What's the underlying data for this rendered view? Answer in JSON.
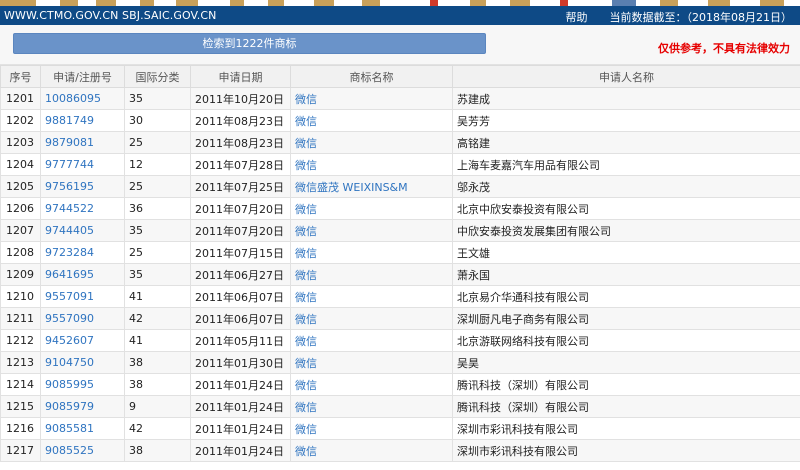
{
  "header": {
    "site": "WWW.CTMO.GOV.CN SBJ.SAIC.GOV.CN",
    "help": "帮助",
    "data_date": "当前数据截至：（2018年08月21日）"
  },
  "banner": {
    "result_button": "检索到1222件商标",
    "disclaimer": "仅供参考，不具有法律效力"
  },
  "colors": {
    "header_bg": "#0e4a86",
    "button_bg": "#6a93c9",
    "link": "#2f74c0",
    "disclaimer": "#e60000"
  },
  "table": {
    "columns": [
      "序号",
      "申请/注册号",
      "国际分类",
      "申请日期",
      "商标名称",
      "申请人名称"
    ],
    "rows": [
      {
        "seq": "1201",
        "reg": "10086095",
        "cls": "35",
        "date": "2011年10月20日",
        "mark": "微信",
        "applicant": "苏建成"
      },
      {
        "seq": "1202",
        "reg": "9881749",
        "cls": "30",
        "date": "2011年08月23日",
        "mark": "微信",
        "applicant": "吴芳芳"
      },
      {
        "seq": "1203",
        "reg": "9879081",
        "cls": "25",
        "date": "2011年08月23日",
        "mark": "微信",
        "applicant": "高铭建"
      },
      {
        "seq": "1204",
        "reg": "9777744",
        "cls": "12",
        "date": "2011年07月28日",
        "mark": "微信",
        "applicant": "上海车麦嘉汽车用品有限公司"
      },
      {
        "seq": "1205",
        "reg": "9756195",
        "cls": "25",
        "date": "2011年07月25日",
        "mark": "微信盛茂 WEIXINS&M",
        "applicant": "邬永茂"
      },
      {
        "seq": "1206",
        "reg": "9744522",
        "cls": "36",
        "date": "2011年07月20日",
        "mark": "微信",
        "applicant": "北京中欣安泰投资有限公司"
      },
      {
        "seq": "1207",
        "reg": "9744405",
        "cls": "35",
        "date": "2011年07月20日",
        "mark": "微信",
        "applicant": "中欣安泰投资发展集团有限公司"
      },
      {
        "seq": "1208",
        "reg": "9723284",
        "cls": "25",
        "date": "2011年07月15日",
        "mark": "微信",
        "applicant": "王文雄"
      },
      {
        "seq": "1209",
        "reg": "9641695",
        "cls": "35",
        "date": "2011年06月27日",
        "mark": "微信",
        "applicant": "萧永国"
      },
      {
        "seq": "1210",
        "reg": "9557091",
        "cls": "41",
        "date": "2011年06月07日",
        "mark": "微信",
        "applicant": "北京易介华通科技有限公司"
      },
      {
        "seq": "1211",
        "reg": "9557090",
        "cls": "42",
        "date": "2011年06月07日",
        "mark": "微信",
        "applicant": "深圳厨凡电子商务有限公司"
      },
      {
        "seq": "1212",
        "reg": "9452607",
        "cls": "41",
        "date": "2011年05月11日",
        "mark": "微信",
        "applicant": "北京游联网络科技有限公司"
      },
      {
        "seq": "1213",
        "reg": "9104750",
        "cls": "38",
        "date": "2011年01月30日",
        "mark": "微信",
        "applicant": "吴昊"
      },
      {
        "seq": "1214",
        "reg": "9085995",
        "cls": "38",
        "date": "2011年01月24日",
        "mark": "微信",
        "applicant": "腾讯科技（深圳）有限公司"
      },
      {
        "seq": "1215",
        "reg": "9085979",
        "cls": "9",
        "date": "2011年01月24日",
        "mark": "微信",
        "applicant": "腾讯科技（深圳）有限公司"
      },
      {
        "seq": "1216",
        "reg": "9085581",
        "cls": "42",
        "date": "2011年01月24日",
        "mark": "微信",
        "applicant": "深圳市彩讯科技有限公司"
      },
      {
        "seq": "1217",
        "reg": "9085525",
        "cls": "38",
        "date": "2011年01月24日",
        "mark": "微信",
        "applicant": "深圳市彩讯科技有限公司"
      }
    ]
  }
}
